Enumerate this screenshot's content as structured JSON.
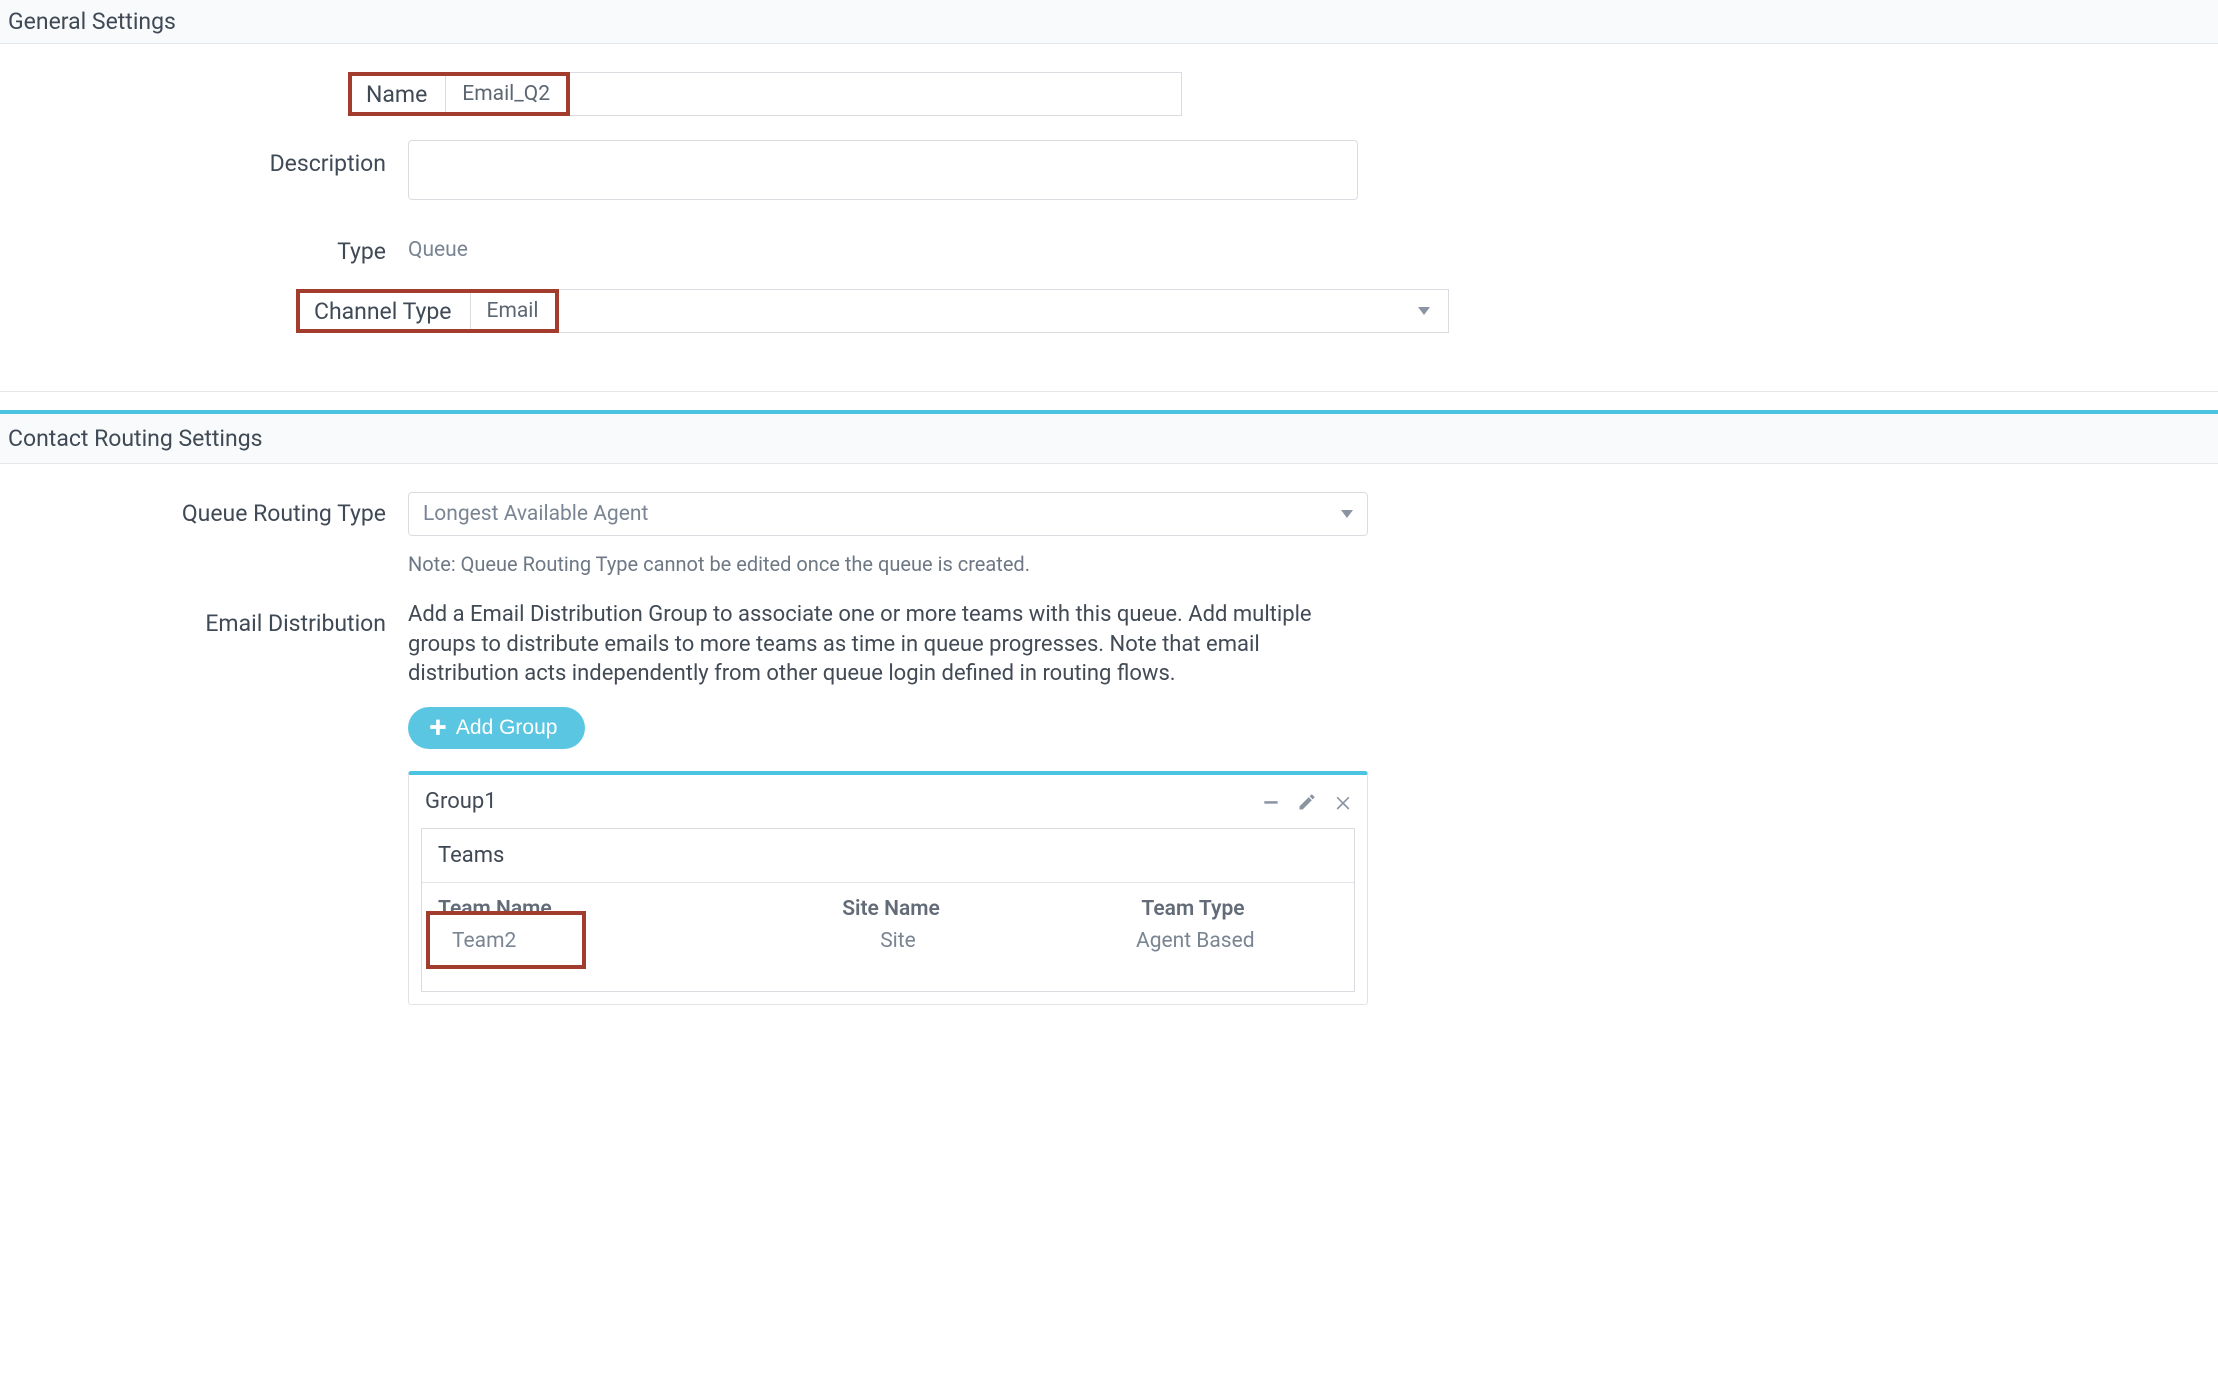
{
  "sections": {
    "general": "General Settings",
    "routing": "Contact Routing Settings"
  },
  "general": {
    "name_label": "Name",
    "name_value": "Email_Q2",
    "description_label": "Description",
    "description_value": "",
    "type_label": "Type",
    "type_value": "Queue",
    "channel_type_label": "Channel Type",
    "channel_type_value": "Email"
  },
  "routing": {
    "queue_routing_type_label": "Queue Routing Type",
    "queue_routing_type_value": "Longest Available Agent",
    "queue_routing_note": "Note: Queue Routing Type cannot be edited once the queue is created.",
    "email_distribution_label": "Email Distribution",
    "email_distribution_body": "Add a Email Distribution Group to associate one or more teams with this queue. Add multiple groups to distribute emails to more teams as time in queue progresses. Note that email distribution acts independently from other queue login defined in routing flows.",
    "add_group_button": "Add Group"
  },
  "group": {
    "title": "Group1",
    "sub_title": "Teams",
    "columns": {
      "team_name": "Team Name",
      "site_name": "Site Name",
      "team_type": "Team Type"
    },
    "rows": [
      {
        "team_name": "Team2",
        "site_name": "Site",
        "team_type": "Agent Based"
      }
    ]
  }
}
